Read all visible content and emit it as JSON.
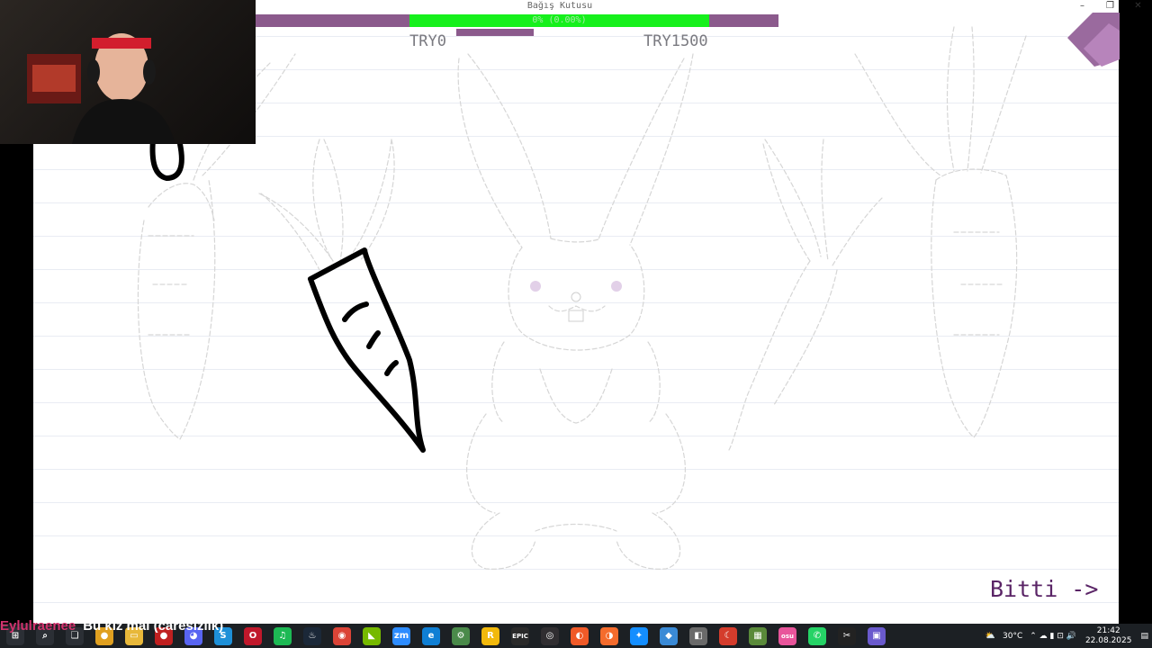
{
  "window": {
    "minimize": "–",
    "restore": "❐",
    "close": "✕"
  },
  "donation": {
    "title": "Bağış Kutusu",
    "percent_label": "0% (0.00%)",
    "min_label": "TRY0",
    "max_label": "TRY1500",
    "progress": 0
  },
  "done_button": {
    "label": "Bitti ->"
  },
  "chat": {
    "username": "Eylulraenee",
    "message": "Bu kız mal (caresizlik)"
  },
  "taskbar": {
    "icons": [
      {
        "name": "windows-start-icon",
        "glyph": "⊞",
        "color": "#2b2f35"
      },
      {
        "name": "search-icon",
        "glyph": "⌕",
        "color": "#2b2f35"
      },
      {
        "name": "task-view-icon",
        "glyph": "❏",
        "color": "#2b2f35"
      },
      {
        "name": "chrome-colored-icon",
        "glyph": "●",
        "color": "#e0a020"
      },
      {
        "name": "file-explorer-icon",
        "glyph": "▭",
        "color": "#e8b83a"
      },
      {
        "name": "record-icon",
        "glyph": "●",
        "color": "#c02020"
      },
      {
        "name": "discord-icon",
        "glyph": "◕",
        "color": "#5865f2"
      },
      {
        "name": "skype-icon",
        "glyph": "S",
        "color": "#1e90d8"
      },
      {
        "name": "opera-icon",
        "glyph": "O",
        "color": "#c0182b"
      },
      {
        "name": "spotify-icon",
        "glyph": "♫",
        "color": "#1db954"
      },
      {
        "name": "steam-icon",
        "glyph": "♨",
        "color": "#1b2838"
      },
      {
        "name": "chrome-icon",
        "glyph": "◉",
        "color": "#db4437"
      },
      {
        "name": "nvidia-icon",
        "glyph": "◣",
        "color": "#76b900"
      },
      {
        "name": "zoom-icon",
        "glyph": "zm",
        "color": "#2d8cff"
      },
      {
        "name": "edge-icon",
        "glyph": "e",
        "color": "#0f7fd4"
      },
      {
        "name": "cheat-engine-icon",
        "glyph": "⚙",
        "color": "#4a8a4a"
      },
      {
        "name": "rockstar-icon",
        "glyph": "R",
        "color": "#f2b90c"
      },
      {
        "name": "epic-games-icon",
        "glyph": "EPIC",
        "color": "#2a2a2a"
      },
      {
        "name": "obs-icon",
        "glyph": "◎",
        "color": "#302e31"
      },
      {
        "name": "ea-icon",
        "glyph": "◐",
        "color": "#f05a28"
      },
      {
        "name": "origin-icon",
        "glyph": "◑",
        "color": "#f56c2d"
      },
      {
        "name": "battlenet-icon",
        "glyph": "✦",
        "color": "#148eff"
      },
      {
        "name": "launcher-icon",
        "glyph": "◆",
        "color": "#3a8ad6"
      },
      {
        "name": "app-icon",
        "glyph": "◧",
        "color": "#6a6a6a"
      },
      {
        "name": "moon-icon",
        "glyph": "☾",
        "color": "#d43c2c"
      },
      {
        "name": "minecraft-icon",
        "glyph": "▦",
        "color": "#5a8a3a"
      },
      {
        "name": "osu-icon",
        "glyph": "osu",
        "color": "#e8559b"
      },
      {
        "name": "whatsapp-icon",
        "glyph": "✆",
        "color": "#25d366"
      },
      {
        "name": "capcut-icon",
        "glyph": "✂",
        "color": "#222222"
      },
      {
        "name": "active-app-icon",
        "glyph": "▣",
        "color": "#6a5acd"
      }
    ],
    "weather_icon": "cloud-sun-icon",
    "temperature": "30°C",
    "tray_glyphs": "⌃ ☁ ▮ ⊡ 🔊",
    "time": "21:42",
    "date": "22.08.2025",
    "notification_glyph": "▤"
  }
}
